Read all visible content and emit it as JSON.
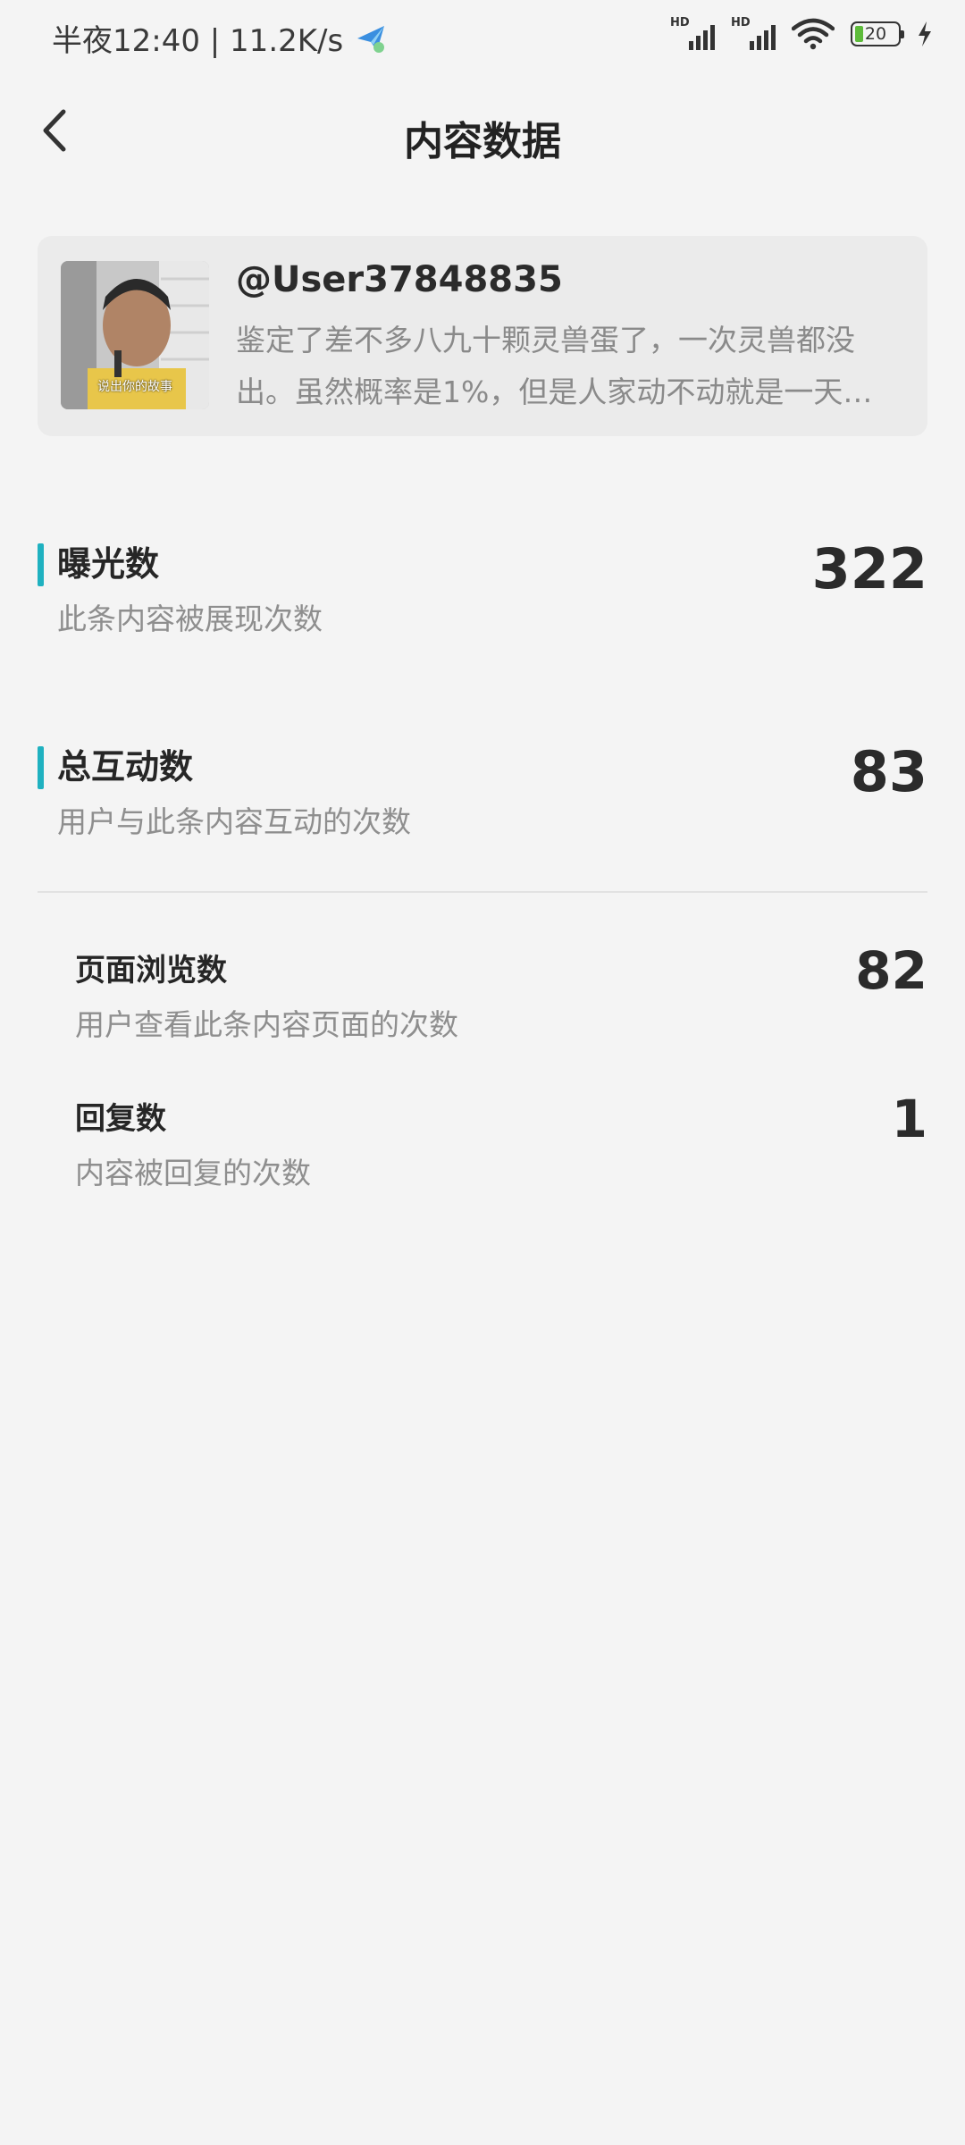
{
  "status_bar": {
    "time_speed": "半夜12:40 | 11.2K/s",
    "signal_hd_1": "HD",
    "signal_hd_2": "HD",
    "battery_level": "20",
    "colors": {
      "battery_fill": "#5dbb3a",
      "app_icon": "#3a8fe0"
    }
  },
  "header": {
    "title": "内容数据",
    "back_icon": "chevron-left-icon"
  },
  "post": {
    "username": "@User37848835",
    "excerpt": "鉴定了差不多八九十颗灵兽蛋了，一次灵兽都没出。虽然概率是1%，但是人家动不动就是一天…",
    "thumbnail_caption": "说出你的故事"
  },
  "metrics": {
    "accent_color": "#1fb1c0",
    "exposure": {
      "title": "曝光数",
      "desc": "此条内容被展现次数",
      "value": "322"
    },
    "interactions": {
      "title": "总互动数",
      "desc": "用户与此条内容互动的次数",
      "value": "83"
    }
  },
  "sub_metrics": {
    "page_views": {
      "title": "页面浏览数",
      "desc": "用户查看此条内容页面的次数",
      "value": "82"
    },
    "replies": {
      "title": "回复数",
      "desc": "内容被回复的次数",
      "value": "1"
    }
  }
}
